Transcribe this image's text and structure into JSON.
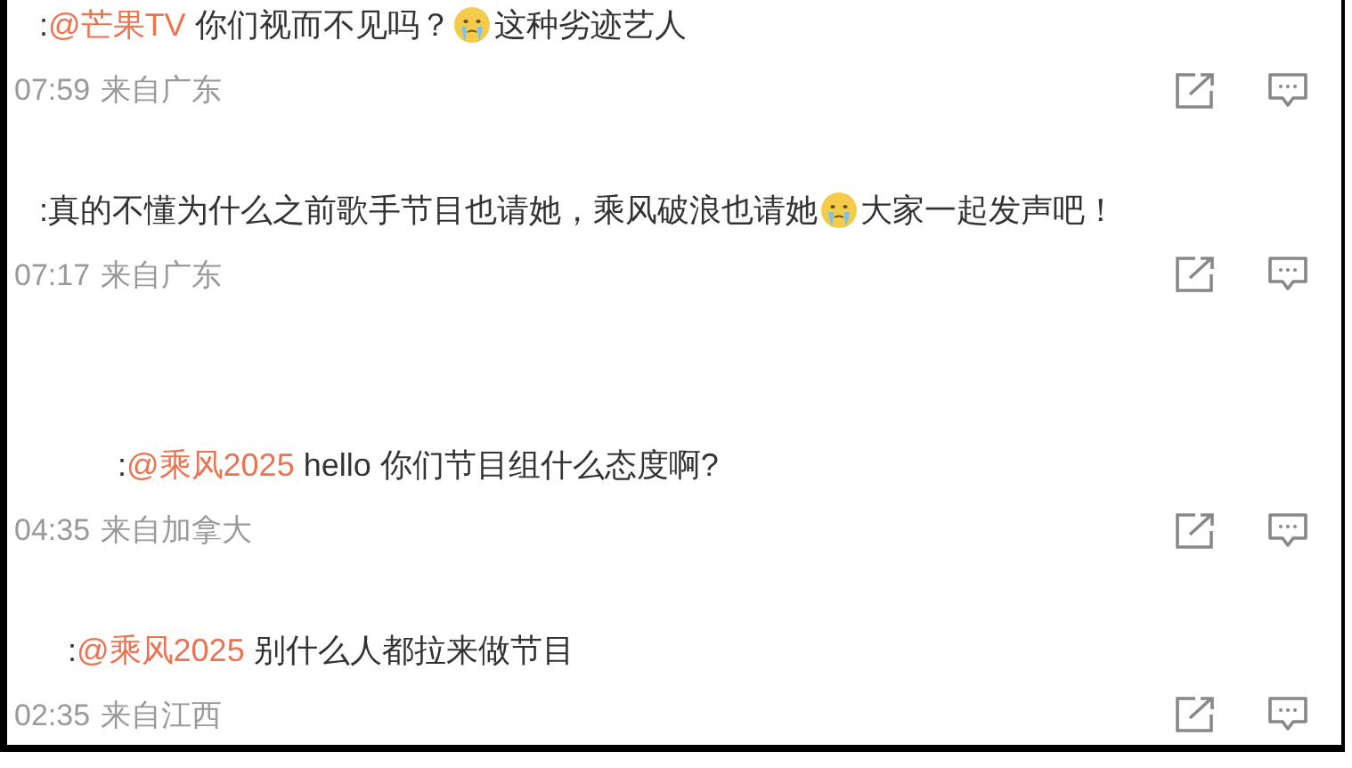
{
  "comments": [
    {
      "parts": [
        {
          "kind": "text",
          "text": ":"
        },
        {
          "kind": "mention",
          "text": "@芒果TV"
        },
        {
          "kind": "text",
          "text": " 你们视而不见吗？"
        },
        {
          "kind": "emoji"
        },
        {
          "kind": "text",
          "text": "这种劣迹艺人"
        }
      ],
      "time": "07:59",
      "location": "来自广东"
    },
    {
      "parts": [
        {
          "kind": "text",
          "text": ":真的不懂为什么之前歌手节目也请她，乘风破浪也请她"
        },
        {
          "kind": "emoji"
        },
        {
          "kind": "text",
          "text": "大家一起发声吧！"
        }
      ],
      "time": "07:17",
      "location": "来自广东"
    },
    {
      "parts": [
        {
          "kind": "text",
          "text": ":"
        },
        {
          "kind": "mention",
          "text": "@乘风2025"
        },
        {
          "kind": "text",
          "text": " hello 你们节目组什么态度啊?"
        }
      ],
      "time": "04:35",
      "location": "来自加拿大"
    },
    {
      "parts": [
        {
          "kind": "text",
          "text": ":"
        },
        {
          "kind": "mention",
          "text": "@乘风2025"
        },
        {
          "kind": "text",
          "text": " 别什么人都拉来做节目"
        }
      ],
      "time": "02:35",
      "location": "来自江西"
    }
  ]
}
